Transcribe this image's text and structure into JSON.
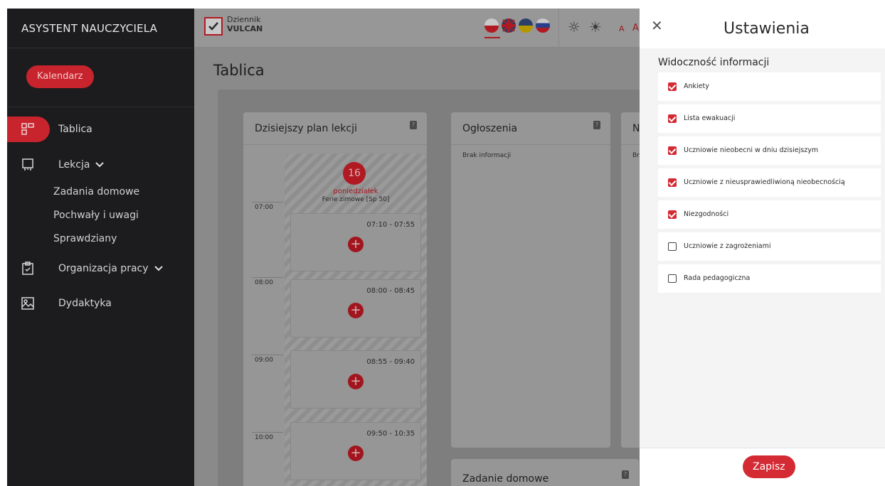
{
  "sidebar": {
    "title": "ASYSTENT NAUCZYCIELA",
    "calendar_button": "Kalendarz",
    "items": [
      {
        "label": "Tablica"
      },
      {
        "label": "Lekcja"
      },
      {
        "label": "Organizacja pracy"
      },
      {
        "label": "Dydaktyka"
      }
    ],
    "lekcja_sub": [
      "Zadania domowe",
      "Pochwały i uwagi",
      "Sprawdziany"
    ]
  },
  "header": {
    "logo_line1": "Dziennik",
    "logo_line2": "VULCAN",
    "font_small": "A",
    "font_large": "A"
  },
  "main": {
    "title": "Tablica",
    "plan": {
      "title": "Dzisiejszy plan lekcji",
      "day_number": "16",
      "day_name": "poniedziałek",
      "day_note": "Ferie zimowe [Sp 50]",
      "hours": [
        "07:00",
        "08:00",
        "09:00",
        "10:00"
      ],
      "slots": [
        "07:10 - 07:55",
        "08:00 - 08:45",
        "08:55 - 09:40",
        "09:50 - 10:35"
      ]
    },
    "announcements": {
      "title": "Ogłoszenia",
      "empty": "Brak informacji"
    },
    "third_card": {
      "title": "N",
      "empty": "Br"
    },
    "homework": {
      "title": "Zadanie domowe"
    }
  },
  "settings": {
    "title": "Ustawienia",
    "section": "Widoczność informacji",
    "options": [
      {
        "label": "Ankiety",
        "checked": true
      },
      {
        "label": "Lista ewakuacji",
        "checked": true
      },
      {
        "label": "Uczniowie nieobecni w dniu dzisiejszym",
        "checked": true
      },
      {
        "label": "Uczniowie z nieusprawiedliwioną nieobecnością",
        "checked": true
      },
      {
        "label": "Niezgodności",
        "checked": true
      },
      {
        "label": "Uczniowie z zagrożeniami",
        "checked": false
      },
      {
        "label": "Rada pedagogiczna",
        "checked": false
      }
    ],
    "save_label": "Zapisz"
  },
  "colors": {
    "accent": "#d42a34",
    "sidebar_bg": "#1c1c1f"
  }
}
